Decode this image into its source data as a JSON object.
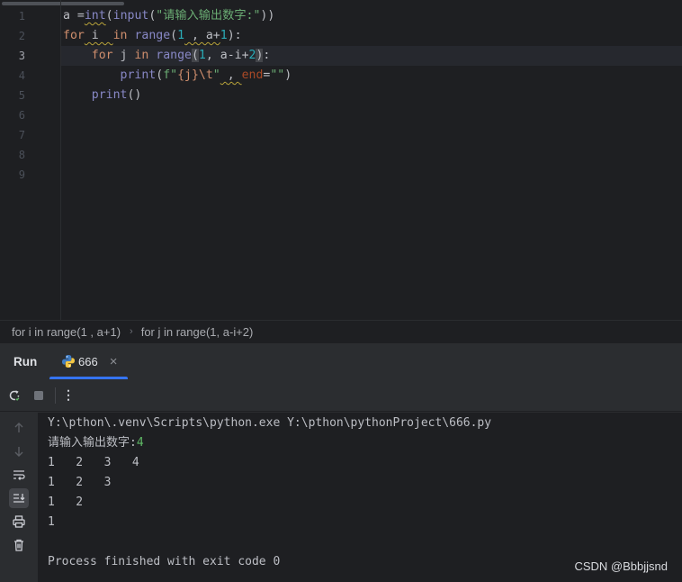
{
  "editor": {
    "line_numbers": [
      "1",
      "2",
      "3",
      "4",
      "5",
      "6",
      "7",
      "8",
      "9"
    ],
    "active_line": 3,
    "code": {
      "l1": {
        "var": "a ",
        "eq": "=",
        "int": "int",
        "p1": "(",
        "input": "input",
        "p2": "(",
        "str": "\"请输入输出数字:\"",
        "p3": "))"
      },
      "l2": {
        "for": "for",
        "sp1": " i  ",
        "in": "in",
        "sp2": " ",
        "range": "range",
        "p1": "(",
        "n1": "1",
        "rest": " , a+",
        "n2": "1",
        "p2": "):"
      },
      "l3": {
        "indent": "    ",
        "for": "for",
        "sp1": " j ",
        "in": "in",
        "sp2": " ",
        "range": "range",
        "p1": "(",
        "n1": "1",
        "mid": ", a-i+",
        "n2": "2",
        "p2": ")",
        "colon": ":"
      },
      "l4": {
        "indent": "        ",
        "print": "print",
        "p1": "(",
        "fpre": "f\"",
        "fb": "{j}",
        "esc": "\\t",
        "fq": "\"",
        "comma": " , ",
        "end": "end",
        "eqq": "=",
        "empty": "\"\"",
        "p2": ")"
      },
      "l5": {
        "indent": "    ",
        "print": "print",
        "p": "()"
      }
    }
  },
  "breadcrumbs": [
    "for i in range(1 , a+1)",
    "for j in range(1, a-i+2)"
  ],
  "run_window": {
    "title": "Run",
    "tab_label": "666",
    "tab_close": "×",
    "output": {
      "cmd": "Y:\\pthon\\.venv\\Scripts\\python.exe Y:\\pthon\\pythonProject\\666.py",
      "prompt": "请输入输出数字:",
      "user_input": "4",
      "rows": [
        "1\t2\t3\t4",
        "1\t2\t3",
        "1\t2",
        "1"
      ],
      "rows_rendered": [
        "1   2   3   4",
        "1   2   3",
        "1   2",
        "1"
      ],
      "exit": "Process finished with exit code 0"
    }
  },
  "watermark": "CSDN @Bbbjjsnd",
  "colors": {
    "accent": "#3574f0",
    "editor_bg": "#1e1f22",
    "panel_bg": "#2b2d30",
    "keyword": "#cf8e6d",
    "string": "#6aab73",
    "number": "#2aacb8",
    "input_green": "#5fb865"
  }
}
